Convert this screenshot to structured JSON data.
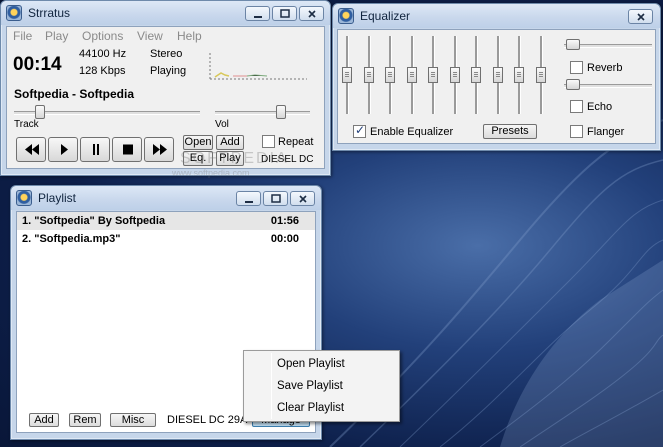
{
  "desktop": {
    "watermark_site": "www.softpedia.com",
    "watermark_brand": "SOFTPEDIA"
  },
  "player": {
    "title": "Strratus",
    "menu": [
      "File",
      "Play",
      "Options",
      "View",
      "Help"
    ],
    "time": "00:14",
    "frequency": "44100 Hz",
    "bitrate": "128  Kbps",
    "channels": "Stereo",
    "status": "Playing",
    "track_title": "Softpedia - Softpedia",
    "track_label": "Track",
    "vol_label": "Vol",
    "track_position": 0.12,
    "volume_level": 0.72,
    "buttons": {
      "open": "Open",
      "add": "Add",
      "eq": "Eq.",
      "play": "Play"
    },
    "repeat_label": "Repeat",
    "repeat_checked": false,
    "skin_name": "DIESEL DC",
    "transport_icons": [
      "rewind-icon",
      "play-icon",
      "pause-icon",
      "stop-icon",
      "fast-forward-icon"
    ]
  },
  "equalizer": {
    "title": "Equalizer",
    "band_levels": [
      0.5,
      0.5,
      0.5,
      0.5,
      0.5,
      0.5,
      0.5,
      0.5,
      0.5,
      0.5
    ],
    "enable_label": "Enable Equalizer",
    "enable_checked": true,
    "presets_label": "Presets",
    "effects": [
      {
        "label": "Reverb",
        "checked": false
      },
      {
        "label": "Echo",
        "checked": false
      },
      {
        "label": "Flanger",
        "checked": false
      }
    ]
  },
  "playlist": {
    "title": "Playlist",
    "items": [
      {
        "name": "1. \"Softpedia\" By Softpedia",
        "time": "01:56"
      },
      {
        "name": "2. \"Softpedia.mp3\"",
        "time": "00:00"
      }
    ],
    "buttons": {
      "add": "Add",
      "rem": "Rem",
      "misc": "Misc",
      "manage": "Manage"
    },
    "skin_name": "DIESEL DC 29A"
  },
  "context_menu": {
    "items": [
      "Open Playlist",
      "Save Playlist",
      "Clear Playlist"
    ]
  }
}
